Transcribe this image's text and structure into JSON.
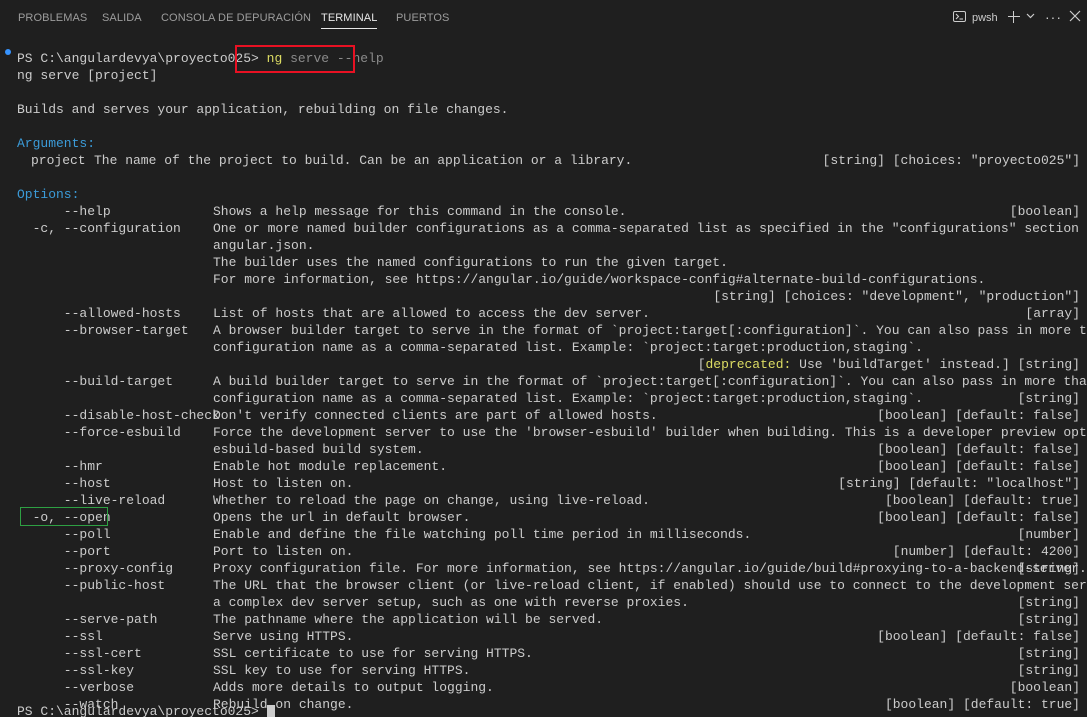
{
  "tabs": [
    "PROBLEMAS",
    "SALIDA",
    "CONSOLA DE DEPURACIÓN",
    "TERMINAL",
    "PUERTOS"
  ],
  "active_tab": "TERMINAL",
  "toolbar": {
    "shell_label": "pwsh"
  },
  "prompt": {
    "path": "PS C:\\angulardevya\\proyecto025>",
    "cmd": "ng",
    "args": "serve --help"
  },
  "usage": "ng serve [project]",
  "summary": "Builds and serves your application, rebuilding on file changes.",
  "arguments_heading": "Arguments:",
  "argument": {
    "name": "project",
    "desc": "The name of the project to build. Can be an application or a library.",
    "type": "[string] [choices: \"proyecto025\"]"
  },
  "options_heading": "Options:",
  "options": [
    {
      "opt": "      --help",
      "desc": [
        "Shows a help message for this command in the console."
      ],
      "type": "[boolean]"
    },
    {
      "opt": "  -c, --configuration",
      "desc": [
        "One or more named builder configurations as a comma-separated list as specified in the \"configurations\" section in",
        "angular.json.",
        "The builder uses the named configurations to run the given target.",
        "For more information, see https://angular.io/guide/workspace-config#alternate-build-configurations."
      ],
      "type": "[string] [choices: \"development\", \"production\"]"
    },
    {
      "opt": "      --allowed-hosts",
      "desc": [
        "List of hosts that are allowed to access the dev server."
      ],
      "type": "[array]"
    },
    {
      "opt": "      --browser-target",
      "desc": [
        "A browser builder target to serve in the format of `project:target[:configuration]`. You can also pass in more than one",
        "configuration name as a comma-separated list. Example: `project:target:production,staging`."
      ],
      "deprecated_label": "deprecated:",
      "type": "Use 'buildTarget' instead.] [string]"
    },
    {
      "opt": "      --build-target",
      "desc": [
        "A build builder target to serve in the format of `project:target[:configuration]`. You can also pass in more than one",
        "configuration name as a comma-separated list. Example: `project:target:production,staging`."
      ],
      "type": "[string]"
    },
    {
      "opt": "      --disable-host-check",
      "desc": [
        "Don't verify connected clients are part of allowed hosts."
      ],
      "type": "[boolean] [default: false]"
    },
    {
      "opt": "      --force-esbuild",
      "desc": [
        "Force the development server to use the 'browser-esbuild' builder when building. This is a developer preview option for the",
        "esbuild-based build system."
      ],
      "type": "[boolean] [default: false]"
    },
    {
      "opt": "      --hmr",
      "desc": [
        "Enable hot module replacement."
      ],
      "type": "[boolean] [default: false]"
    },
    {
      "opt": "      --host",
      "desc": [
        "Host to listen on."
      ],
      "type": "[string] [default: \"localhost\"]"
    },
    {
      "opt": "      --live-reload",
      "desc": [
        "Whether to reload the page on change, using live-reload."
      ],
      "type": "[boolean] [default: true]"
    },
    {
      "opt": "  -o, --open",
      "desc": [
        "Opens the url in default browser."
      ],
      "type": "[boolean] [default: false]"
    },
    {
      "opt": "      --poll",
      "desc": [
        "Enable and define the file watching poll time period in milliseconds."
      ],
      "type": "[number]"
    },
    {
      "opt": "      --port",
      "desc": [
        "Port to listen on."
      ],
      "type": "[number] [default: 4200]"
    },
    {
      "opt": "      --proxy-config",
      "desc": [
        "Proxy configuration file. For more information, see https://angular.io/guide/build#proxying-to-a-backend-server."
      ],
      "type": "[string]"
    },
    {
      "opt": "      --public-host",
      "desc": [
        "The URL that the browser client (or live-reload client, if enabled) should use to connect to the development server. Use for",
        "a complex dev server setup, such as one with reverse proxies."
      ],
      "type": "[string]"
    },
    {
      "opt": "      --serve-path",
      "desc": [
        "The pathname where the application will be served."
      ],
      "type": "[string]"
    },
    {
      "opt": "      --ssl",
      "desc": [
        "Serve using HTTPS."
      ],
      "type": "[boolean] [default: false]"
    },
    {
      "opt": "      --ssl-cert",
      "desc": [
        "SSL certificate to use for serving HTTPS."
      ],
      "type": "[string]"
    },
    {
      "opt": "      --ssl-key",
      "desc": [
        "SSL key to use for serving HTTPS."
      ],
      "type": "[string]"
    },
    {
      "opt": "      --verbose",
      "desc": [
        "Adds more details to output logging."
      ],
      "type": "[boolean]"
    },
    {
      "opt": "      --watch",
      "desc": [
        "Rebuild on change."
      ],
      "type": "[boolean] [default: true]"
    }
  ],
  "last_prompt": "PS C:\\angulardevya\\proyecto025> ",
  "colors": {
    "background": "#1f1f1f",
    "heading": "#3b9bd8",
    "command": "#dcdc63",
    "highlight_red": "#e81123",
    "highlight_green": "#2ea043"
  }
}
